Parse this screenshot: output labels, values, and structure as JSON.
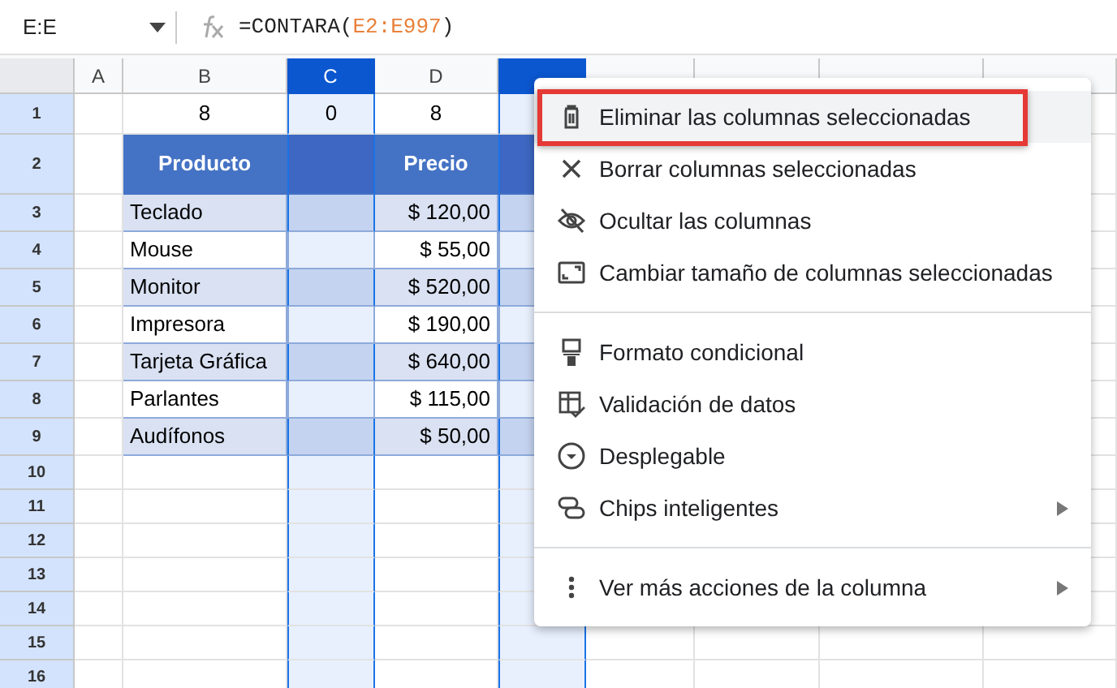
{
  "formula_bar": {
    "name_box": "E:E",
    "formula": [
      {
        "text": "=CONTARA(",
        "kind": "plain"
      },
      {
        "text": "E2:E997",
        "kind": "range"
      },
      {
        "text": ")",
        "kind": "plain"
      }
    ]
  },
  "columns": [
    {
      "label": "A",
      "selected": false
    },
    {
      "label": "B",
      "selected": false
    },
    {
      "label": "C",
      "selected": true
    },
    {
      "label": "D",
      "selected": false
    },
    {
      "selected": true
    },
    {
      "selected": false
    },
    {
      "selected": false
    },
    {
      "selected": false
    },
    {
      "selected": false
    }
  ],
  "rows": [
    {
      "number": "1",
      "kind": "plain",
      "cells": [
        "",
        "8",
        "0",
        "8",
        ""
      ]
    },
    {
      "number": "2",
      "kind": "header",
      "cells": [
        "",
        "Producto",
        "",
        "Precio",
        ""
      ]
    },
    {
      "number": "3",
      "kind": "band",
      "cells": [
        "",
        "Teclado",
        "",
        "$ 120,00",
        ""
      ]
    },
    {
      "number": "4",
      "kind": "data",
      "cells": [
        "",
        "Mouse",
        "",
        "$ 55,00",
        ""
      ]
    },
    {
      "number": "5",
      "kind": "band",
      "cells": [
        "",
        "Monitor",
        "",
        "$ 520,00",
        ""
      ]
    },
    {
      "number": "6",
      "kind": "data",
      "cells": [
        "",
        "Impresora",
        "",
        "$ 190,00",
        ""
      ]
    },
    {
      "number": "7",
      "kind": "band",
      "cells": [
        "",
        "Tarjeta Gráfica",
        "",
        "$ 640,00",
        ""
      ]
    },
    {
      "number": "8",
      "kind": "data",
      "cells": [
        "",
        "Parlantes",
        "",
        "$ 115,00",
        ""
      ]
    },
    {
      "number": "9",
      "kind": "band",
      "cells": [
        "",
        "Audífonos",
        "",
        "$ 50,00",
        ""
      ]
    },
    {
      "number": "10",
      "kind": "plain",
      "cells": [
        "",
        "",
        "",
        "",
        ""
      ]
    },
    {
      "number": "11",
      "kind": "plain",
      "cells": [
        "",
        "",
        "",
        "",
        ""
      ]
    },
    {
      "number": "12",
      "kind": "plain",
      "cells": [
        "",
        "",
        "",
        "",
        ""
      ]
    },
    {
      "number": "13",
      "kind": "plain",
      "cells": [
        "",
        "",
        "",
        "",
        ""
      ]
    },
    {
      "number": "14",
      "kind": "plain",
      "cells": [
        "",
        "",
        "",
        "",
        ""
      ]
    },
    {
      "number": "15",
      "kind": "plain",
      "cells": [
        "",
        "",
        "",
        "",
        ""
      ]
    },
    {
      "number": "16",
      "kind": "plain",
      "cells": [
        "",
        "",
        "",
        "",
        ""
      ]
    }
  ],
  "context_menu": [
    {
      "kind": "item",
      "label": "Eliminar las columnas seleccionadas",
      "highlighted": true,
      "submenu": false
    },
    {
      "kind": "item",
      "label": "Borrar columnas seleccionadas",
      "highlighted": false,
      "submenu": false
    },
    {
      "kind": "item",
      "label": "Ocultar las columnas",
      "highlighted": false,
      "submenu": false
    },
    {
      "kind": "item",
      "label": "Cambiar tamaño de columnas seleccionadas",
      "highlighted": false,
      "submenu": false
    },
    {
      "kind": "divider"
    },
    {
      "kind": "item",
      "label": "Formato condicional",
      "highlighted": false,
      "submenu": false
    },
    {
      "kind": "item",
      "label": "Validación de datos",
      "highlighted": false,
      "submenu": false
    },
    {
      "kind": "item",
      "label": "Desplegable",
      "highlighted": false,
      "submenu": false
    },
    {
      "kind": "item",
      "label": "Chips inteligentes",
      "highlighted": false,
      "submenu": true
    },
    {
      "kind": "divider"
    },
    {
      "kind": "item",
      "label": "Ver más acciones de la columna",
      "highlighted": false,
      "submenu": true
    }
  ]
}
